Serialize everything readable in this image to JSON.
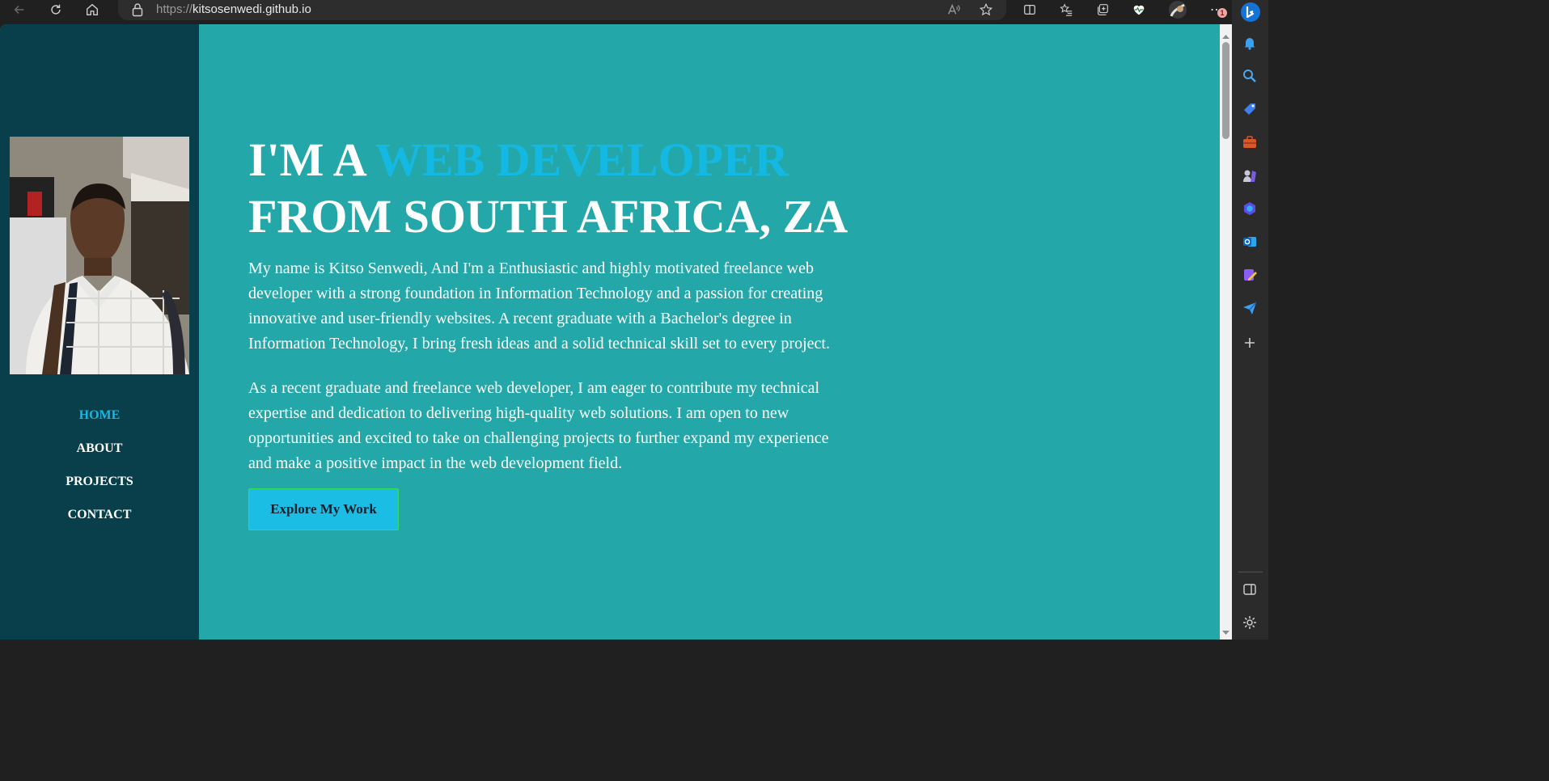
{
  "browser": {
    "url_scheme": "https://",
    "url_host": "kitsosenwedi.github.io",
    "notification_count": "1"
  },
  "site": {
    "nav": [
      {
        "label": "HOME",
        "active": true
      },
      {
        "label": "ABOUT",
        "active": false
      },
      {
        "label": "PROJECTS",
        "active": false
      },
      {
        "label": "CONTACT",
        "active": false
      }
    ],
    "headline": {
      "prefix": "I'M A ",
      "accent": "WEB DEVELOPER",
      "line2": "FROM SOUTH AFRICA, ZA"
    },
    "paragraph_1": "My name is Kitso Senwedi, And I'm a Enthusiastic and highly motivated freelance web developer with a strong foundation in Information Technology and a passion for creating innovative and user-friendly websites. A recent graduate with a Bachelor's degree in Information Technology, I bring fresh ideas and a solid technical skill set to every project.",
    "paragraph_2": "As a recent graduate and freelance web developer, I am eager to contribute my technical expertise and dedication to delivering high-quality web solutions. I am open to new opportunities and excited to take on challenging projects to further expand my experience and make a positive impact in the web development field.",
    "cta_label": "Explore My Work"
  },
  "colors": {
    "page_bg": "#24a7a9",
    "sidebar_bg": "#093f4a",
    "accent": "#14b9e3",
    "button_bg": "#1cbde5",
    "button_border": "#37dd55"
  },
  "icons": {
    "toolbar_left": [
      "back-icon",
      "refresh-icon",
      "home-icon"
    ],
    "toolbar_right": [
      "read-aloud-icon",
      "favorite-star-icon",
      "split-screen-icon",
      "favorites-icon",
      "collections-icon",
      "browser-essentials-icon",
      "profile-avatar-icon",
      "more-options-icon",
      "bing-copilot-icon"
    ],
    "edge_sidebar": [
      "notifications-icon",
      "search-icon",
      "shopping-icon",
      "tools-icon",
      "games-icon",
      "microsoft-365-icon",
      "outlook-icon",
      "designer-icon",
      "send-icon",
      "add-icon",
      "hide-sidebar-icon",
      "settings-icon"
    ]
  }
}
